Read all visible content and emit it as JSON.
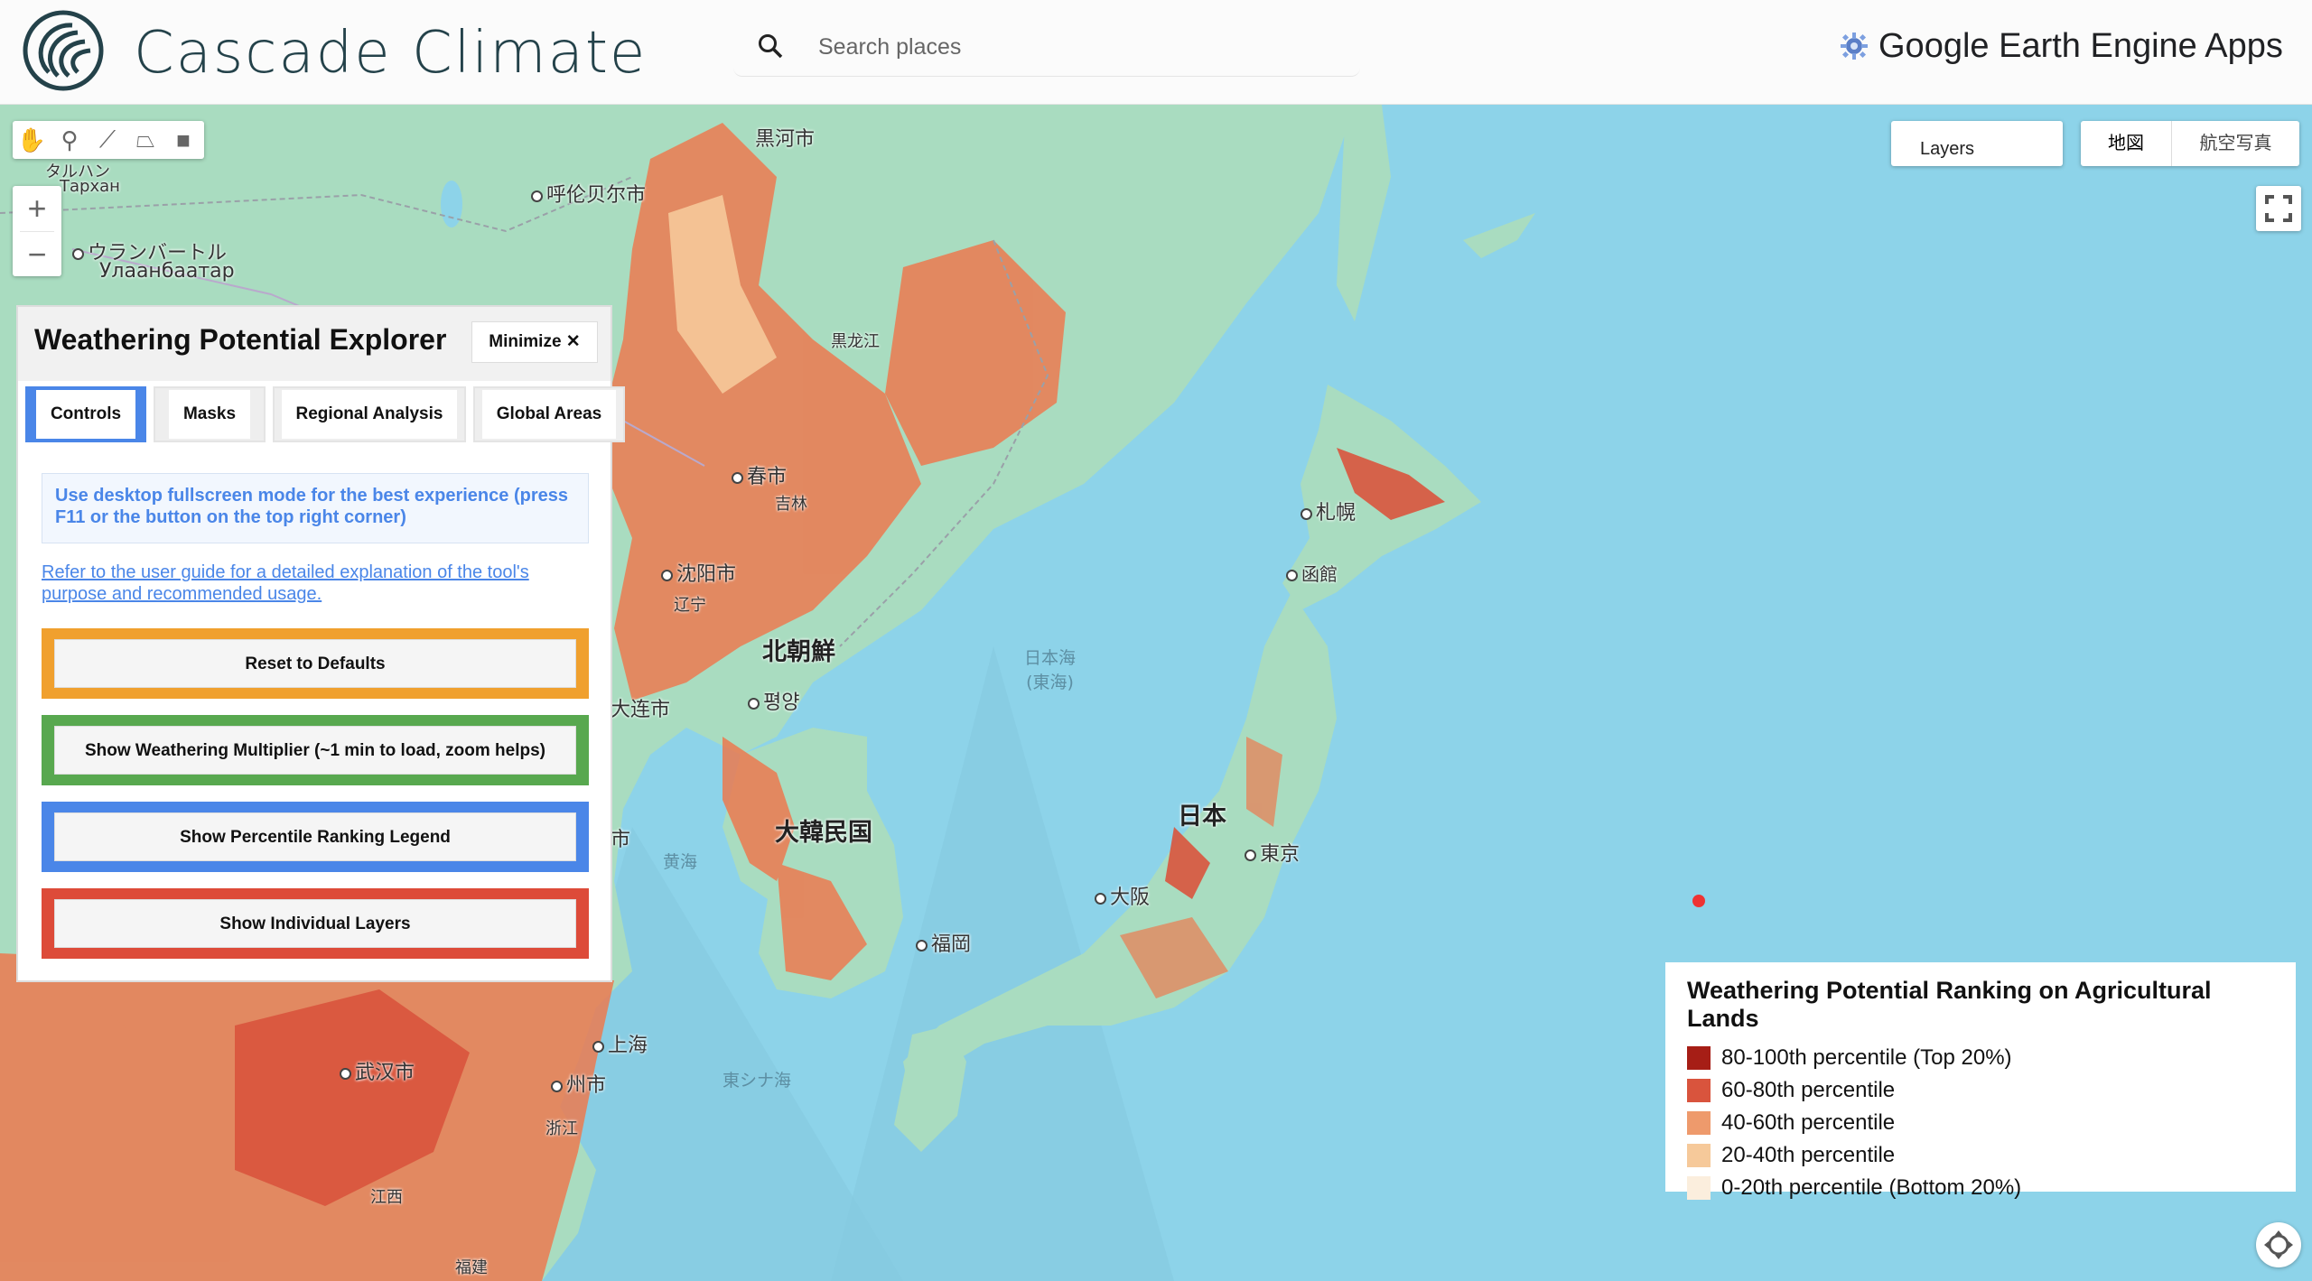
{
  "header": {
    "app_title": "Cascade Climate",
    "search_placeholder": "Search places",
    "gee_label": "Google Earth Engine Apps"
  },
  "map_controls": {
    "layers_label": "Layers",
    "map_type_options": [
      "地図",
      "航空写真"
    ],
    "selected_map_type": "地図",
    "zoom_in": "+",
    "zoom_out": "−"
  },
  "map_labels": {
    "heihe": "黒河市",
    "hulunbuir": "呼伦贝尔市",
    "tarhan": "タルハン",
    "tarhan_cyr": "Тархан",
    "ulaanbaatar": "ウランバートル",
    "ulaanbaatar_cyr": "Улаанбаатар",
    "heilongjiang": "黒龙江",
    "changchun": "春市",
    "jilin": "吉林",
    "shenyang": "沈阳市",
    "liaoning": "辽宁",
    "dalian": "大连市",
    "north_korea": "北朝鮮",
    "pyongyang": "평양",
    "south_korea": "大韓民国",
    "sea_of_japan": "日本海\n(東海)",
    "yellow_sea": "黄海",
    "east_china_sea": "東シナ海",
    "sapporo": "札幌",
    "hakodate": "函館",
    "japan": "日本",
    "tokyo": "東京",
    "osaka": "大阪",
    "fukuoka": "福岡",
    "shanghai": "上海",
    "wuhan": "武汉市",
    "zhejiang": "浙江",
    "jiangxi": "江西",
    "fujian": "福建",
    "hangzhou": "州市",
    "city_left": "市"
  },
  "panel": {
    "title": "Weathering Potential Explorer",
    "minimize_label": "Minimize ✕",
    "tabs": [
      {
        "label": "Controls",
        "active": true
      },
      {
        "label": "Masks",
        "active": false
      },
      {
        "label": "Regional Analysis",
        "active": false
      },
      {
        "label": "Global Areas",
        "active": false
      }
    ],
    "tip": "Use desktop fullscreen mode for the best experience (press F11 or the button on the top right corner)",
    "guide_link": "Refer to the user guide for a detailed explanation of the tool's purpose and recommended usage.",
    "buttons": [
      {
        "label": "Reset to Defaults",
        "color": "#f0a02e"
      },
      {
        "label": "Show Weathering Multiplier (~1 min to load, zoom helps)",
        "color": "#58a84f"
      },
      {
        "label": "Show Percentile Ranking Legend",
        "color": "#4a86e8"
      },
      {
        "label": "Show Individual Layers",
        "color": "#dd4b39"
      }
    ]
  },
  "legend": {
    "title": "Weathering Potential Ranking on Agricultural Lands",
    "items": [
      {
        "label": "80-100th percentile (Top 20%)",
        "color": "#a61e16"
      },
      {
        "label": "60-80th percentile",
        "color": "#d9543d"
      },
      {
        "label": "40-60th percentile",
        "color": "#ee9a6c"
      },
      {
        "label": "20-40th percentile",
        "color": "#f6c99a"
      },
      {
        "label": "0-20th percentile (Bottom 20%)",
        "color": "#fbeedd"
      }
    ]
  },
  "colors": {
    "ocean": "#8dd3e9",
    "land": "#a9dcc0",
    "agri": "#ec7a50"
  }
}
